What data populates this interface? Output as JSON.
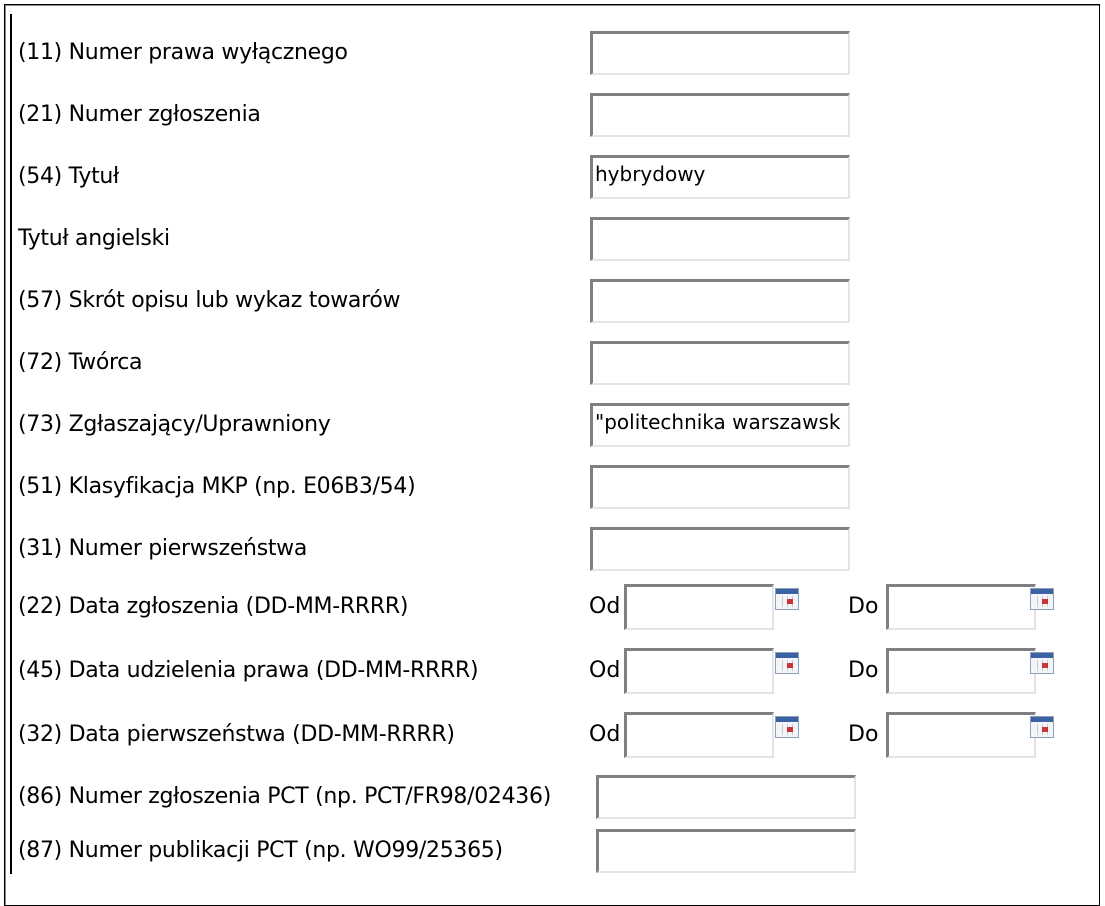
{
  "form": {
    "rows": [
      {
        "label": "(11) Numer prawa wyłącznego",
        "value": ""
      },
      {
        "label": "(21) Numer zgłoszenia",
        "value": ""
      },
      {
        "label": "(54) Tytuł",
        "value": "hybrydowy"
      },
      {
        "label": "Tytuł angielski",
        "value": ""
      },
      {
        "label": "(57) Skrót opisu lub wykaz towarów",
        "value": ""
      },
      {
        "label": "(72) Twórca",
        "value": ""
      },
      {
        "label": "(73) Zgłaszający/Uprawniony",
        "value": "\"politechnika warszawsk"
      },
      {
        "label": "(51) Klasyfikacja MKP (np. E06B3/54)",
        "value": ""
      },
      {
        "label": "(31) Numer pierwszeństwa",
        "value": ""
      }
    ],
    "dates": [
      {
        "label": "(22) Data zgłoszenia (DD-MM-RRRR)",
        "from_label": "Od",
        "to_label": "Do",
        "from_value": "",
        "to_value": ""
      },
      {
        "label": "(45) Data udzielenia prawa (DD-MM-RRRR)",
        "from_label": "Od",
        "to_label": "Do",
        "from_value": "",
        "to_value": ""
      },
      {
        "label": "(32) Data pierwszeństwa (DD-MM-RRRR)",
        "from_label": "Od",
        "to_label": "Do",
        "from_value": "",
        "to_value": ""
      }
    ],
    "pct_rows": [
      {
        "label": "(86) Numer zgłoszenia PCT (np. PCT/FR98/02436)",
        "value": ""
      },
      {
        "label": "(87) Numer publikacji PCT (np. WO99/25365)",
        "value": ""
      }
    ]
  },
  "icons": {
    "calendar": "calendar-icon"
  }
}
